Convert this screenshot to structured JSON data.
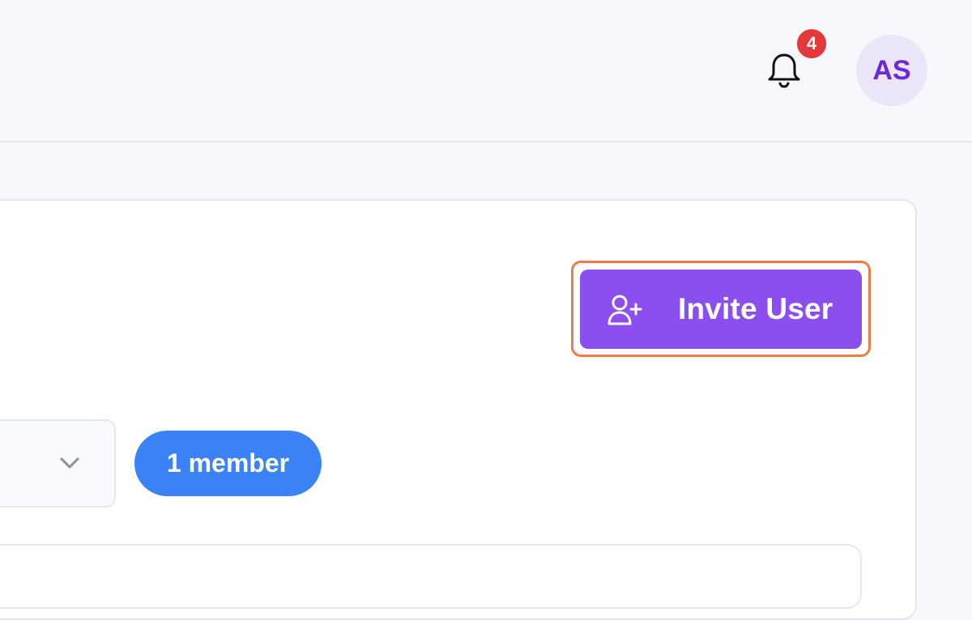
{
  "header": {
    "notifications": {
      "icon": "bell-icon",
      "count": "4",
      "badge_color": "#e5383b"
    },
    "user": {
      "initials": "AS",
      "avatar_bg": "#ece6fb",
      "avatar_color": "#6d28d9"
    }
  },
  "main": {
    "invite_button": {
      "label": "Invite User",
      "icon": "user-plus-icon",
      "color": "#8b4ff0",
      "focus_ring_color": "#ef7b45"
    },
    "filter": {
      "icon": "chevron-down-icon"
    },
    "member_count": {
      "label": "1 member",
      "color": "#3b82f6"
    }
  }
}
